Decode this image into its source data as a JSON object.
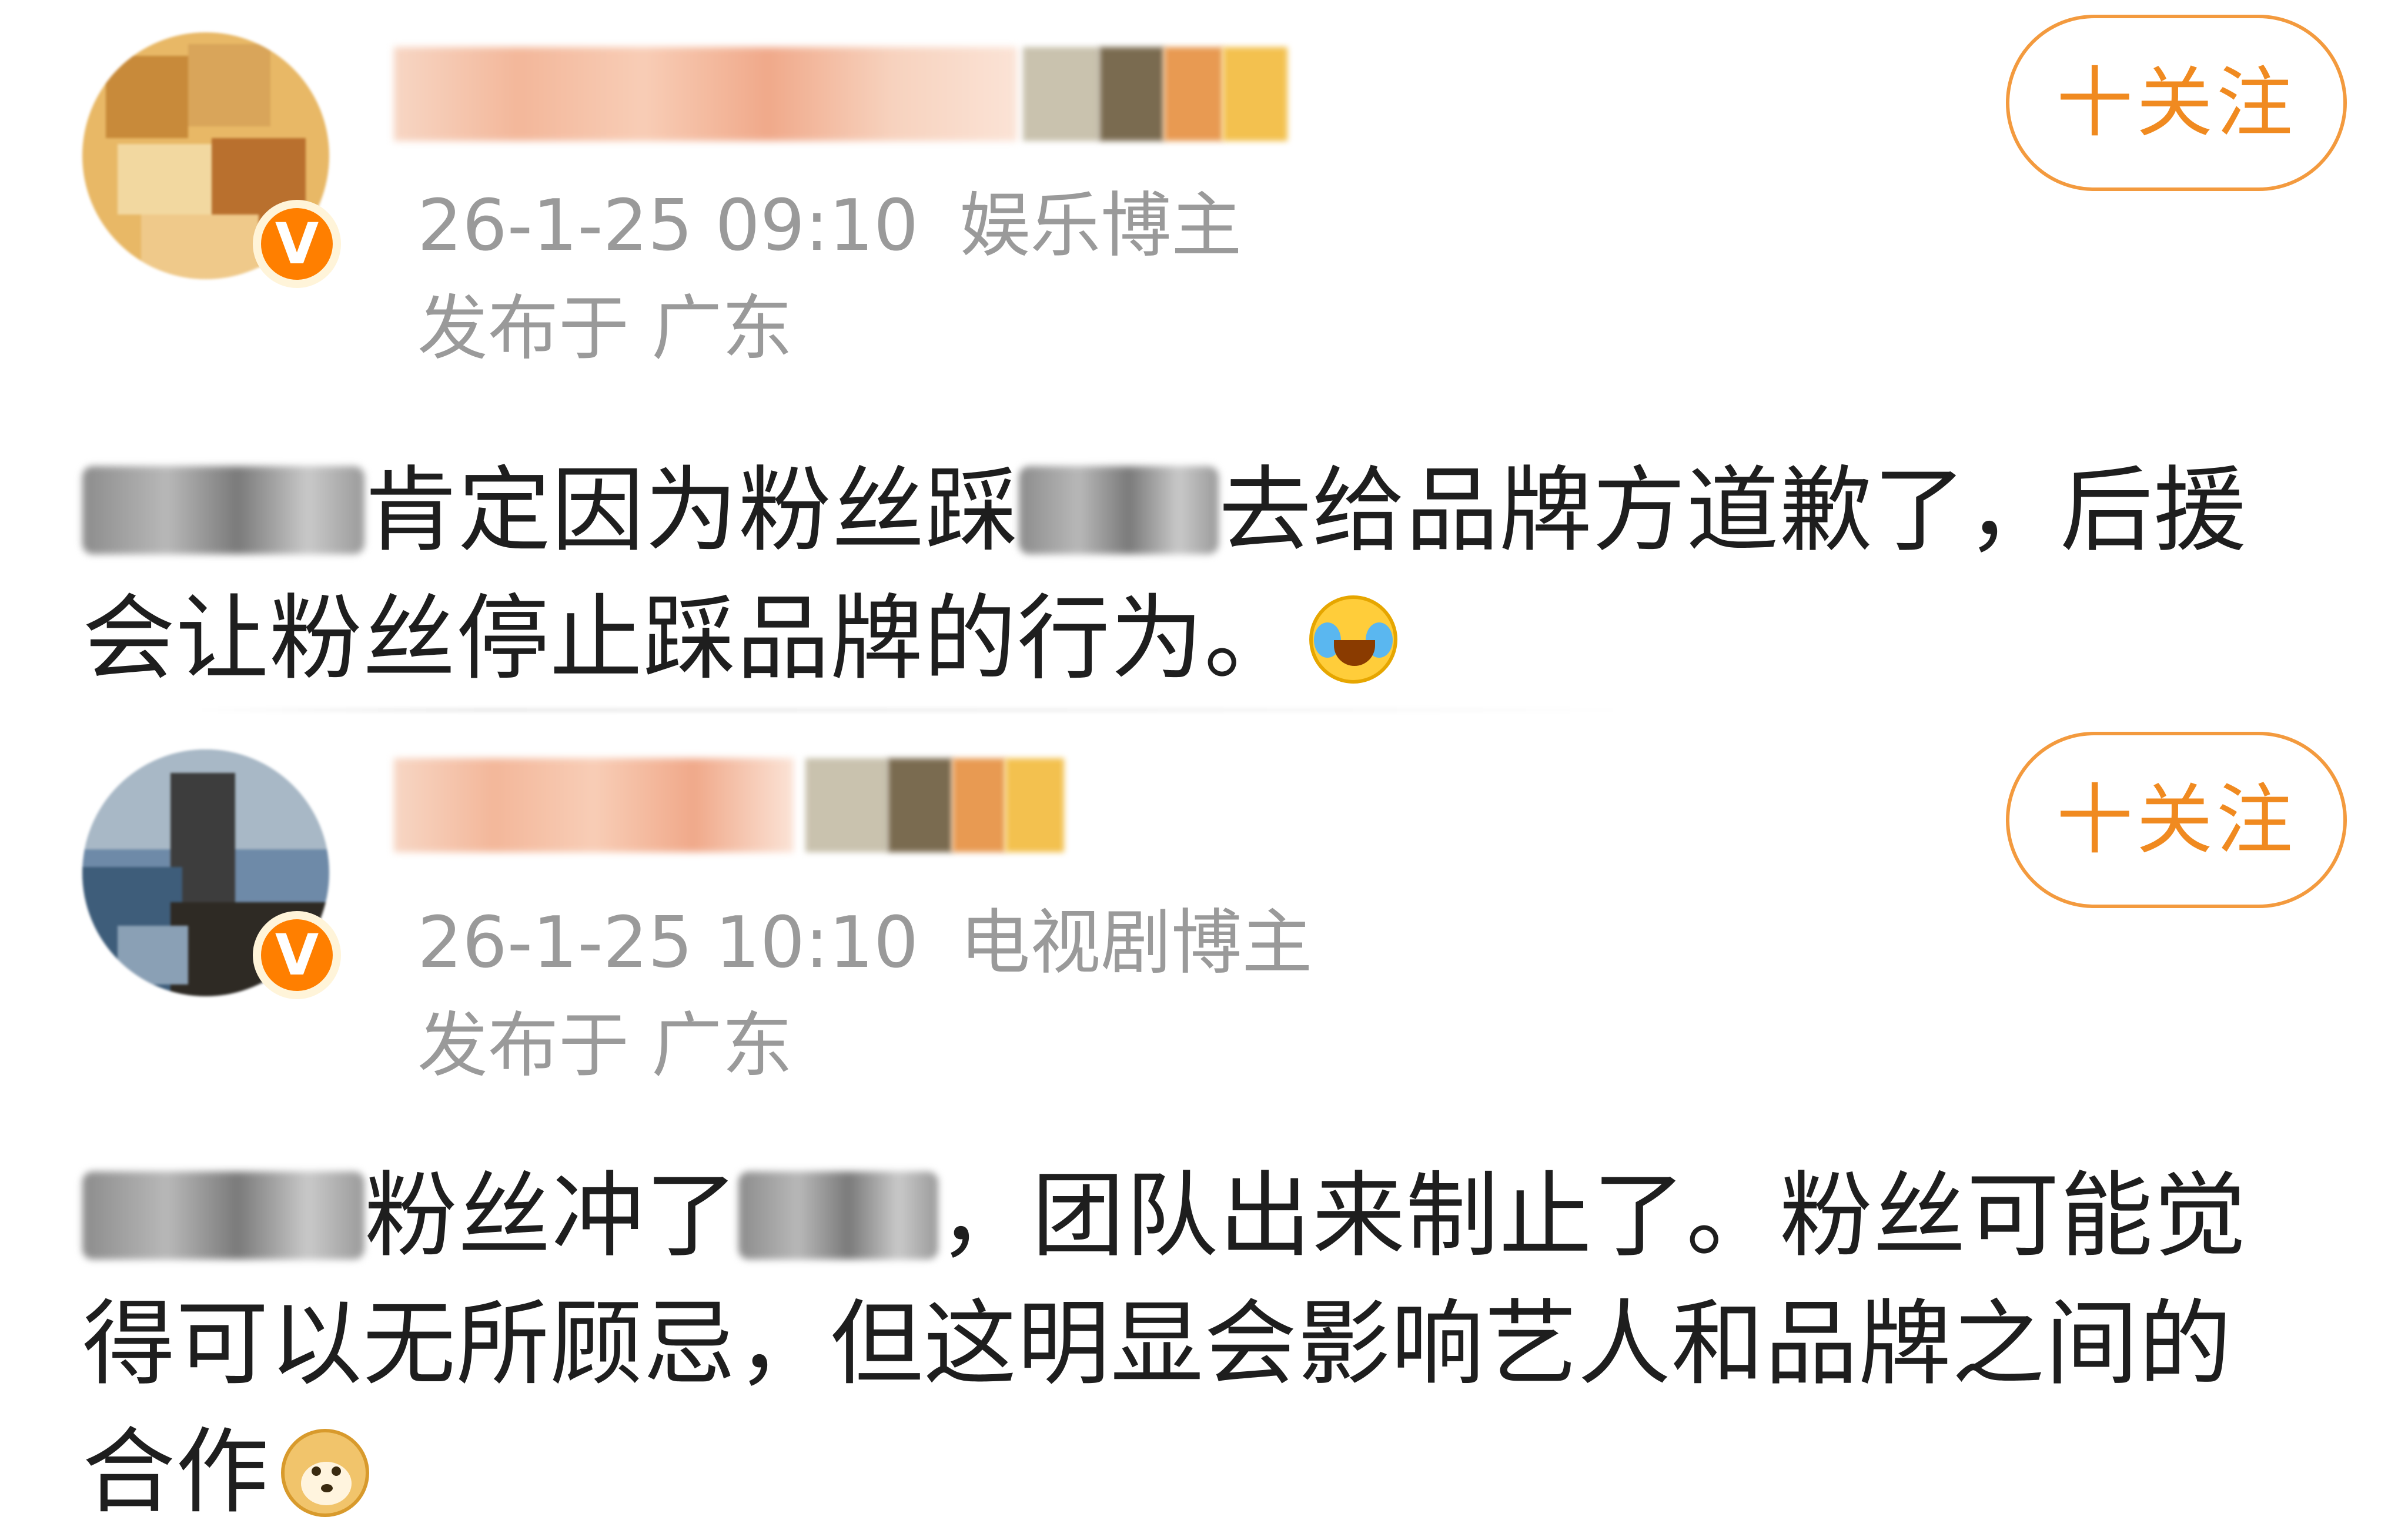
{
  "posts": [
    {
      "author_name": "",
      "time": "26-1-25 09:10",
      "role": "娱乐博主",
      "location": "发布于 广东",
      "follow_label": "十关注",
      "verified_badge": "V",
      "content": {
        "part1": "肯定因为粉丝踩",
        "part2": "去给品牌方道歉了，后援会让粉丝停止踩品牌的行为。"
      },
      "emoji": "laughing-crying-emoji"
    },
    {
      "author_name": "",
      "time": "26-1-25 10:10",
      "role": "电视剧博主",
      "location": "发布于 广东",
      "follow_label": "十关注",
      "verified_badge": "V",
      "content": {
        "part1": "粉丝冲了",
        "part2": "，团队出来制止了。粉丝可能觉得可以无所顾忌，但这明显会影响艺人和品牌之间的合作"
      },
      "emoji": "doge-emoji"
    }
  ],
  "colors": {
    "follow_accent": "#f08a20",
    "verified_badge": "#ff7f00",
    "meta_text": "#9a9a9a",
    "body_text": "#1e1e1e"
  }
}
